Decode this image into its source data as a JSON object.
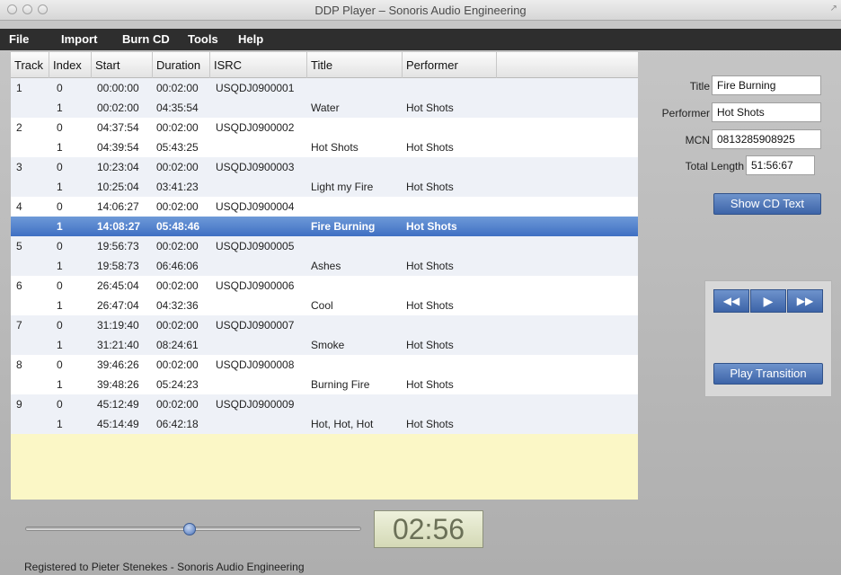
{
  "window": {
    "title": "DDP Player – Sonoris Audio Engineering"
  },
  "menu": {
    "items": [
      "File",
      "Import",
      "Burn CD",
      "Tools",
      "Help"
    ]
  },
  "table": {
    "columns": [
      "Track",
      "Index",
      "Start",
      "Duration",
      "ISRC",
      "Title",
      "Performer"
    ],
    "rows": [
      {
        "track": "1",
        "index": "0",
        "start": "00:00:00",
        "duration": "00:02:00",
        "isrc": "USQDJ0900001",
        "title": "",
        "performer": ""
      },
      {
        "track": "",
        "index": "1",
        "start": "00:02:00",
        "duration": "04:35:54",
        "isrc": "",
        "title": "Water",
        "performer": "Hot Shots"
      },
      {
        "track": "2",
        "index": "0",
        "start": "04:37:54",
        "duration": "00:02:00",
        "isrc": "USQDJ0900002",
        "title": "",
        "performer": ""
      },
      {
        "track": "",
        "index": "1",
        "start": "04:39:54",
        "duration": "05:43:25",
        "isrc": "",
        "title": "Hot Shots",
        "performer": "Hot Shots"
      },
      {
        "track": "3",
        "index": "0",
        "start": "10:23:04",
        "duration": "00:02:00",
        "isrc": "USQDJ0900003",
        "title": "",
        "performer": ""
      },
      {
        "track": "",
        "index": "1",
        "start": "10:25:04",
        "duration": "03:41:23",
        "isrc": "",
        "title": "Light my Fire",
        "performer": "Hot Shots"
      },
      {
        "track": "4",
        "index": "0",
        "start": "14:06:27",
        "duration": "00:02:00",
        "isrc": "USQDJ0900004",
        "title": "",
        "performer": ""
      },
      {
        "track": "",
        "index": "1",
        "start": "14:08:27",
        "duration": "05:48:46",
        "isrc": "",
        "title": "Fire Burning",
        "performer": "Hot Shots"
      },
      {
        "track": "5",
        "index": "0",
        "start": "19:56:73",
        "duration": "00:02:00",
        "isrc": "USQDJ0900005",
        "title": "",
        "performer": ""
      },
      {
        "track": "",
        "index": "1",
        "start": "19:58:73",
        "duration": "06:46:06",
        "isrc": "",
        "title": "Ashes",
        "performer": "Hot Shots"
      },
      {
        "track": "6",
        "index": "0",
        "start": "26:45:04",
        "duration": "00:02:00",
        "isrc": "USQDJ0900006",
        "title": "",
        "performer": ""
      },
      {
        "track": "",
        "index": "1",
        "start": "26:47:04",
        "duration": "04:32:36",
        "isrc": "",
        "title": "Cool",
        "performer": "Hot Shots"
      },
      {
        "track": "7",
        "index": "0",
        "start": "31:19:40",
        "duration": "00:02:00",
        "isrc": "USQDJ0900007",
        "title": "",
        "performer": ""
      },
      {
        "track": "",
        "index": "1",
        "start": "31:21:40",
        "duration": "08:24:61",
        "isrc": "",
        "title": "Smoke",
        "performer": "Hot Shots"
      },
      {
        "track": "8",
        "index": "0",
        "start": "39:46:26",
        "duration": "00:02:00",
        "isrc": "USQDJ0900008",
        "title": "",
        "performer": ""
      },
      {
        "track": "",
        "index": "1",
        "start": "39:48:26",
        "duration": "05:24:23",
        "isrc": "",
        "title": "Burning Fire",
        "performer": "Hot Shots"
      },
      {
        "track": "9",
        "index": "0",
        "start": "45:12:49",
        "duration": "00:02:00",
        "isrc": "USQDJ0900009",
        "title": "",
        "performer": ""
      },
      {
        "track": "",
        "index": "1",
        "start": "45:14:49",
        "duration": "06:42:18",
        "isrc": "",
        "title": "Hot, Hot, Hot",
        "performer": "Hot Shots"
      }
    ],
    "selected_row": 7
  },
  "cd_info": {
    "title_label": "Title",
    "title_value": "Fire Burning",
    "performer_label": "Performer",
    "performer_value": "Hot Shots",
    "mcn_label": "MCN",
    "mcn_value": "0813285908925",
    "total_length_label": "Total Length",
    "total_length_value": "51:56:67",
    "show_cd_text_label": "Show CD Text"
  },
  "transport": {
    "rewind_icon": "rewind-icon",
    "play_icon": "play-icon",
    "fast_forward_icon": "fast-forward-icon",
    "play_transition_label": "Play Transition"
  },
  "position": {
    "time": "02:56",
    "slider_fraction": 0.49
  },
  "status": {
    "text": "Registered to Pieter Stenekes - Sonoris Audio Engineering"
  },
  "colors": {
    "accent": "#4a74bf",
    "selection": "#3f6fc3",
    "table_empty": "#fbf7c6"
  }
}
